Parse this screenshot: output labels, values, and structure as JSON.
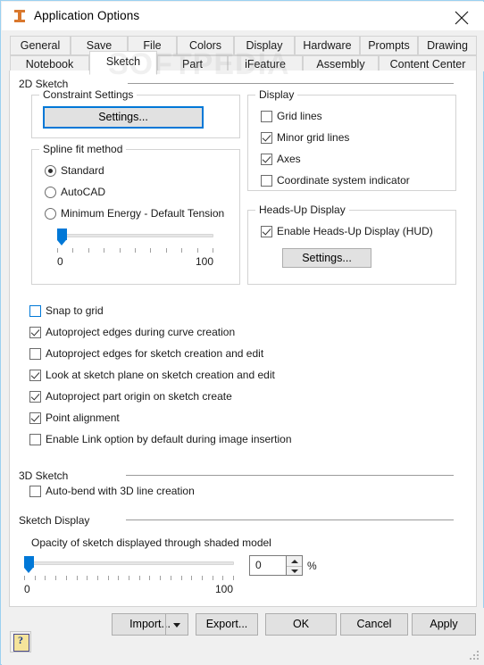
{
  "window": {
    "title": "Application Options",
    "icon": "inventor-app-icon",
    "close_icon": "close-icon",
    "watermark": "SOFTPEDIA"
  },
  "tabs": {
    "row1": [
      {
        "label": "General",
        "active": false
      },
      {
        "label": "Save",
        "active": false
      },
      {
        "label": "File",
        "active": false
      },
      {
        "label": "Colors",
        "active": false
      },
      {
        "label": "Display",
        "active": false
      },
      {
        "label": "Hardware",
        "active": false
      },
      {
        "label": "Prompts",
        "active": false
      },
      {
        "label": "Drawing",
        "active": false
      }
    ],
    "row2": [
      {
        "label": "Notebook",
        "active": false
      },
      {
        "label": "Sketch",
        "active": true
      },
      {
        "label": "Part",
        "active": false
      },
      {
        "label": "iFeature",
        "active": false
      },
      {
        "label": "Assembly",
        "active": false
      },
      {
        "label": "Content Center",
        "active": false
      }
    ]
  },
  "sections": {
    "sketch_2d": "2D Sketch",
    "sketch_3d": "3D Sketch",
    "sketch_display": "Sketch Display"
  },
  "constraint_settings": {
    "title": "Constraint Settings",
    "button_label": "Settings...",
    "button_focused": true
  },
  "spline_fit": {
    "title": "Spline fit method",
    "options": [
      {
        "label": "Standard",
        "selected": true
      },
      {
        "label": "AutoCAD",
        "selected": false
      },
      {
        "label": "Minimum Energy - Default Tension",
        "selected": false
      }
    ],
    "slider": {
      "value": 0,
      "min_label": "0",
      "max_label": "100",
      "min": 0,
      "max": 100,
      "ticks": 11
    }
  },
  "display_group": {
    "title": "Display",
    "items": [
      {
        "label": "Grid lines",
        "checked": false
      },
      {
        "label": "Minor grid lines",
        "checked": true
      },
      {
        "label": "Axes",
        "checked": true
      },
      {
        "label": "Coordinate system indicator",
        "checked": false
      }
    ]
  },
  "hud_group": {
    "title": "Heads-Up Display",
    "enable": {
      "label": "Enable Heads-Up Display (HUD)",
      "checked": true
    },
    "button_label": "Settings..."
  },
  "sketch_options": [
    {
      "label": "Snap to grid",
      "checked": false,
      "hover": true
    },
    {
      "label": "Autoproject edges during curve creation",
      "checked": true,
      "hover": false
    },
    {
      "label": "Autoproject edges for sketch creation and edit",
      "checked": false,
      "hover": false
    },
    {
      "label": "Look at sketch plane on sketch creation and edit",
      "checked": true,
      "hover": false
    },
    {
      "label": "Autoproject part origin on sketch create",
      "checked": true,
      "hover": false
    },
    {
      "label": "Point alignment",
      "checked": true,
      "hover": false
    },
    {
      "label": "Enable Link option by default during image insertion",
      "checked": false,
      "hover": false
    }
  ],
  "sketch_3d_options": [
    {
      "label": "Auto-bend with 3D line creation",
      "checked": false
    }
  ],
  "opacity": {
    "label": "Opacity of sketch displayed through shaded model",
    "slider": {
      "value": 0,
      "min_label": "0",
      "max_label": "100",
      "min": 0,
      "max": 100,
      "ticks": 21
    },
    "value": "0",
    "unit": "%"
  },
  "footer": {
    "help_icon": "help-question-icon",
    "buttons": [
      {
        "label": "Import...",
        "split": true
      },
      {
        "label": "Export...",
        "split": false
      },
      {
        "label": "OK",
        "split": false
      },
      {
        "label": "Cancel",
        "split": false
      },
      {
        "label": "Apply",
        "split": false
      }
    ]
  },
  "colors": {
    "accent": "#0078d7",
    "window_border": "#9bd0f0",
    "chrome": "#f0f0f0",
    "button_face": "#e1e1e1",
    "text": "#1a1a1a"
  }
}
